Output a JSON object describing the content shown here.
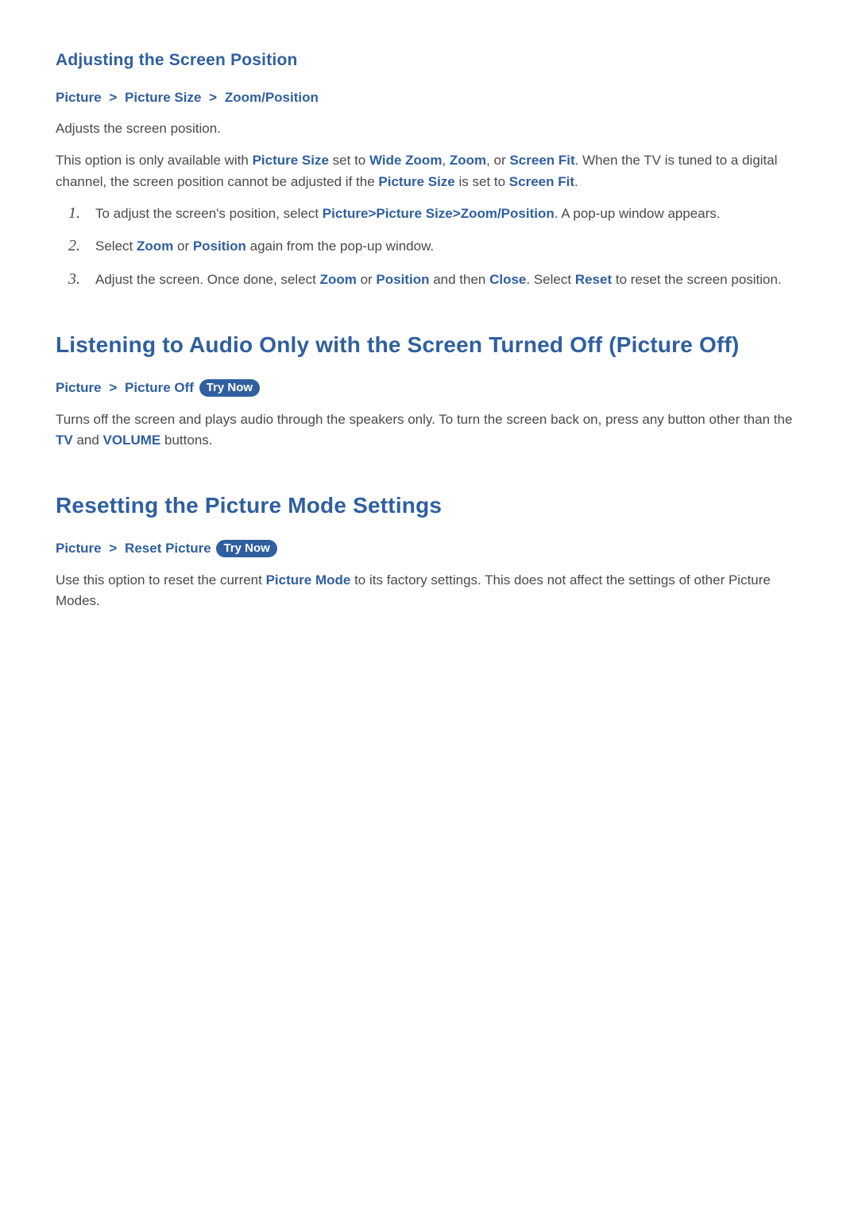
{
  "section1": {
    "heading": "Adjusting the Screen Position",
    "breadcrumb": [
      "Picture",
      "Picture Size",
      "Zoom/Position"
    ],
    "para1": "Adjusts the screen position.",
    "para2": {
      "t1": "This option is only available with ",
      "h1": "Picture Size",
      "t2": " set to ",
      "h2": "Wide Zoom",
      "t3": ", ",
      "h3": "Zoom",
      "t4": ", or ",
      "h4": "Screen Fit",
      "t5": ". When the TV is tuned to a digital channel, the screen position cannot be adjusted if the ",
      "h5": "Picture Size",
      "t6": " is set to ",
      "h6": "Screen Fit",
      "t7": "."
    },
    "steps": {
      "s1": {
        "n": "1.",
        "t1": "To adjust the screen's position, select ",
        "h1": "Picture",
        "h2": "Picture Size",
        "h3": "Zoom/Position",
        "t2": ". A pop-up window appears."
      },
      "s2": {
        "n": "2.",
        "t1": "Select ",
        "h1": "Zoom",
        "t2": " or ",
        "h2": "Position",
        "t3": " again from the pop-up window."
      },
      "s3": {
        "n": "3.",
        "t1": "Adjust the screen. Once done, select ",
        "h1": "Zoom",
        "t2": " or ",
        "h2": "Position",
        "t3": " and then ",
        "h3": "Close",
        "t4": ". Select ",
        "h4": "Reset",
        "t5": " to reset the screen position."
      }
    }
  },
  "section2": {
    "heading": "Listening to Audio Only with the Screen Turned Off (Picture Off)",
    "breadcrumb": [
      "Picture",
      "Picture Off"
    ],
    "tryNow": "Try Now",
    "para": {
      "t1": "Turns off the screen and plays audio through the speakers only. To turn the screen back on, press any button other than the ",
      "h1": "TV",
      "t2": " and ",
      "h2": "VOLUME",
      "t3": " buttons."
    }
  },
  "section3": {
    "heading": "Resetting the Picture Mode Settings",
    "breadcrumb": [
      "Picture",
      "Reset Picture"
    ],
    "tryNow": "Try Now",
    "para": {
      "t1": "Use this option to reset the current ",
      "h1": "Picture Mode",
      "t2": " to its factory settings. This does not affect the settings of other Picture Modes."
    }
  },
  "sepGlyph": ">"
}
